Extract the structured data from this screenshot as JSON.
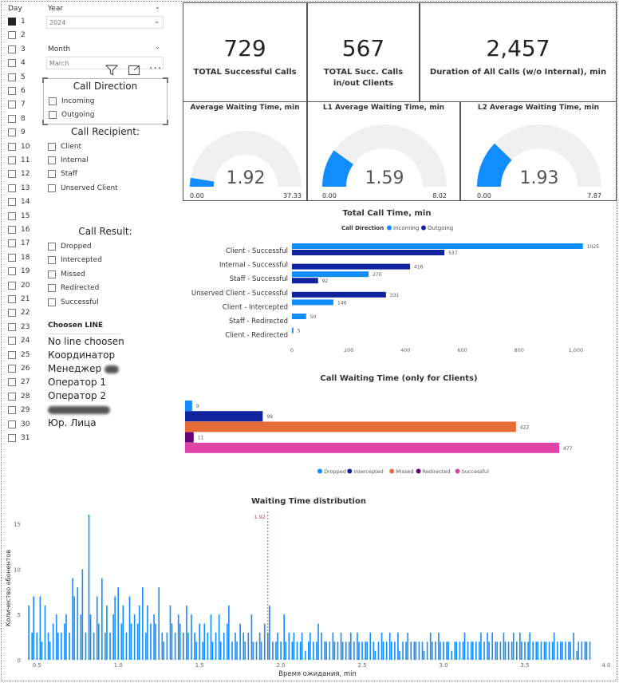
{
  "day_slicer": {
    "title": "Day",
    "days": [
      "1",
      "2",
      "3",
      "4",
      "5",
      "6",
      "7",
      "8",
      "9",
      "10",
      "11",
      "12",
      "13",
      "14",
      "15",
      "16",
      "17",
      "18",
      "19",
      "20",
      "21",
      "22",
      "23",
      "24",
      "25",
      "26",
      "27",
      "28",
      "29",
      "30",
      "31"
    ],
    "selected": "1"
  },
  "year": {
    "label": "Year",
    "value": "2024"
  },
  "month": {
    "label": "Month",
    "value": "March"
  },
  "call_direction": {
    "title": "Call Direction",
    "options": [
      "Incoming",
      "Outgoing"
    ]
  },
  "call_recipient": {
    "title": "Call Recipient:",
    "options": [
      "Client",
      "Internal",
      "Staff",
      "Unserved Client"
    ]
  },
  "call_result": {
    "title": "Call Result:",
    "options": [
      "Dropped",
      "Intercepted",
      "Missed",
      "Redirected",
      "Successful"
    ]
  },
  "choosen_line": {
    "title": "Choosen LINE",
    "items": [
      "No line choosen",
      "Координатор",
      "Менеджер",
      "Оператор 1",
      "Оператор 2",
      "",
      "Юр. Лица"
    ]
  },
  "kpis": [
    {
      "value": "729",
      "label": "TOTAL Successful Calls"
    },
    {
      "value": "567",
      "label": "TOTAL Succ. Calls in/out Clients"
    },
    {
      "value": "2,457",
      "label": "Duration of All Calls (w/o Internal), min"
    }
  ],
  "gauges": [
    {
      "title": "Average Waiting Time, min",
      "value": "1.92",
      "min": "0.00",
      "max": "37.33",
      "fraction": 0.0514
    },
    {
      "title": "L1 Average Waiting Time, min",
      "value": "1.59",
      "min": "0.00",
      "max": "8.02",
      "fraction": 0.198
    },
    {
      "title": "L2 Average Waiting Time, min",
      "value": "1.93",
      "min": "0.00",
      "max": "7.87",
      "fraction": 0.245
    }
  ],
  "colors": {
    "incoming": "#118DFF",
    "outgoing": "#12239E",
    "dropped": "#118DFF",
    "intercepted": "#12239E",
    "missed": "#E66C37",
    "redirected": "#6B007B",
    "successful": "#E044A7",
    "gauge_track": "#F0F0F0"
  },
  "chart_data": [
    {
      "type": "bar",
      "title": "Total Call Time, min",
      "legend_title": "Call Direction",
      "categories": [
        "Client - Successful",
        "Internal - Successful",
        "Staff - Successful",
        "Unserved Client - Successful",
        "Client - Intercepted",
        "Staff - Redirected",
        "Client - Redirected"
      ],
      "series": [
        {
          "name": "Incoming",
          "values": [
            1025,
            null,
            270,
            null,
            146,
            50,
            5
          ]
        },
        {
          "name": "Outgoing",
          "values": [
            537,
            416,
            92,
            331,
            null,
            null,
            null
          ]
        }
      ],
      "xticks": [
        "0",
        "200",
        "400",
        "600",
        "800",
        "1,000"
      ],
      "xlim": [
        0,
        1020
      ]
    },
    {
      "type": "bar",
      "title": "Call Waiting Time (only for Clients)",
      "series": [
        {
          "name": "Dropped",
          "values": [
            9
          ]
        },
        {
          "name": "Intercepted",
          "values": [
            99
          ]
        },
        {
          "name": "Missed",
          "values": [
            422
          ]
        },
        {
          "name": "Redirected",
          "values": [
            11
          ]
        },
        {
          "name": "Successful",
          "values": [
            477
          ]
        }
      ],
      "xlim": [
        0,
        477
      ]
    },
    {
      "type": "bar",
      "title": "Waiting Time distribution",
      "xlabel": "Время ожидания, min",
      "ylabel": "Количество абонентов",
      "xticks": [
        "0.5",
        "1.0",
        "1.5",
        "2.0",
        "2.5",
        "3.0",
        "3.5",
        "4.0"
      ],
      "yticks": [
        "0",
        "5",
        "10",
        "15"
      ],
      "xlim": [
        0.43,
        4.02
      ],
      "ylim": [
        0,
        16
      ],
      "reference_line": {
        "value": 1.92,
        "label": "1.92"
      },
      "x": [
        0.45,
        0.47,
        0.48,
        0.5,
        0.52,
        0.53,
        0.55,
        0.57,
        0.58,
        0.6,
        0.62,
        0.63,
        0.65,
        0.67,
        0.68,
        0.7,
        0.72,
        0.73,
        0.75,
        0.77,
        0.78,
        0.8,
        0.82,
        0.83,
        0.85,
        0.87,
        0.88,
        0.9,
        0.92,
        0.93,
        0.95,
        0.97,
        0.98,
        1.0,
        1.02,
        1.03,
        1.05,
        1.07,
        1.08,
        1.1,
        1.12,
        1.13,
        1.15,
        1.17,
        1.18,
        1.2,
        1.22,
        1.23,
        1.25,
        1.27,
        1.28,
        1.3,
        1.32,
        1.33,
        1.35,
        1.37,
        1.38,
        1.4,
        1.42,
        1.43,
        1.45,
        1.47,
        1.48,
        1.5,
        1.52,
        1.53,
        1.55,
        1.57,
        1.58,
        1.6,
        1.62,
        1.63,
        1.65,
        1.67,
        1.68,
        1.7,
        1.72,
        1.73,
        1.75,
        1.77,
        1.78,
        1.8,
        1.82,
        1.83,
        1.85,
        1.87,
        1.88,
        1.9,
        1.92,
        1.93,
        1.95,
        1.97,
        1.98,
        2.0,
        2.02,
        2.03,
        2.05,
        2.07,
        2.08,
        2.1,
        2.12,
        2.13,
        2.15,
        2.17,
        2.18,
        2.2,
        2.22,
        2.23,
        2.25,
        2.27,
        2.28,
        2.3,
        2.32,
        2.33,
        2.35,
        2.37,
        2.38,
        2.4,
        2.42,
        2.43,
        2.45,
        2.47,
        2.48,
        2.5,
        2.52,
        2.53,
        2.55,
        2.57,
        2.58,
        2.6,
        2.62,
        2.63,
        2.65,
        2.67,
        2.68,
        2.7,
        2.72,
        2.73,
        2.75,
        2.77,
        2.78,
        2.8,
        2.82,
        2.83,
        2.85,
        2.87,
        2.88,
        2.9,
        2.92,
        2.93,
        2.95,
        2.97,
        2.98,
        3.0,
        3.02,
        3.03,
        3.05,
        3.07,
        3.08,
        3.1,
        3.12,
        3.13,
        3.15,
        3.17,
        3.18,
        3.2,
        3.22,
        3.23,
        3.25,
        3.27,
        3.28,
        3.3,
        3.32,
        3.33,
        3.35,
        3.37,
        3.38,
        3.4,
        3.42,
        3.43,
        3.45,
        3.47,
        3.48,
        3.5,
        3.52,
        3.53,
        3.55,
        3.57,
        3.58,
        3.6,
        3.62,
        3.63,
        3.65,
        3.67,
        3.68,
        3.7,
        3.72,
        3.73,
        3.75,
        3.77,
        3.78,
        3.8,
        3.82,
        3.83,
        3.85,
        3.87,
        3.88,
        3.9,
        3.92,
        3.93,
        3.95,
        3.97,
        3.98,
        4.0
      ],
      "values": [
        6,
        3,
        7,
        3,
        7,
        2,
        6,
        3,
        2,
        4,
        5,
        3,
        3,
        4,
        5,
        3,
        9,
        7,
        8,
        5,
        10,
        3,
        16,
        5,
        3,
        7,
        4,
        9,
        3,
        6,
        3,
        5,
        7,
        8,
        4,
        6,
        3,
        7,
        4,
        5,
        4,
        6,
        8,
        3,
        6,
        4,
        5,
        4,
        8,
        3,
        2,
        3,
        6,
        4,
        3,
        5,
        4,
        3,
        6,
        3,
        5,
        3,
        2,
        4,
        2,
        4,
        3,
        5,
        2,
        3,
        5,
        2,
        3,
        4,
        6,
        2,
        3,
        2,
        4,
        3,
        2,
        3,
        5,
        2,
        2,
        3,
        2,
        4,
        3,
        6,
        2,
        2,
        3,
        2,
        5,
        2,
        3,
        2,
        3,
        2,
        2,
        3,
        1,
        2,
        3,
        2,
        2,
        4,
        3,
        2,
        2,
        2,
        3,
        2,
        2,
        3,
        2,
        2,
        2,
        3,
        2,
        3,
        2,
        2,
        2,
        2,
        3,
        2,
        1,
        2,
        3,
        2,
        2,
        3,
        2,
        2,
        3,
        1,
        2,
        2,
        3,
        2,
        2,
        2,
        2,
        2,
        1,
        2,
        3,
        2,
        2,
        3,
        2,
        2,
        2,
        2,
        1,
        2,
        2,
        2,
        2,
        3,
        2,
        2,
        2,
        2,
        2,
        3,
        2,
        3,
        2,
        3,
        2,
        2,
        2,
        3,
        2,
        2,
        2,
        3,
        2,
        3,
        2,
        2,
        2,
        3,
        2,
        2,
        2,
        2,
        2,
        2,
        2,
        2,
        3,
        2,
        2,
        2,
        2,
        2,
        2,
        3,
        1,
        2,
        2,
        2,
        2,
        2
      ]
    }
  ]
}
